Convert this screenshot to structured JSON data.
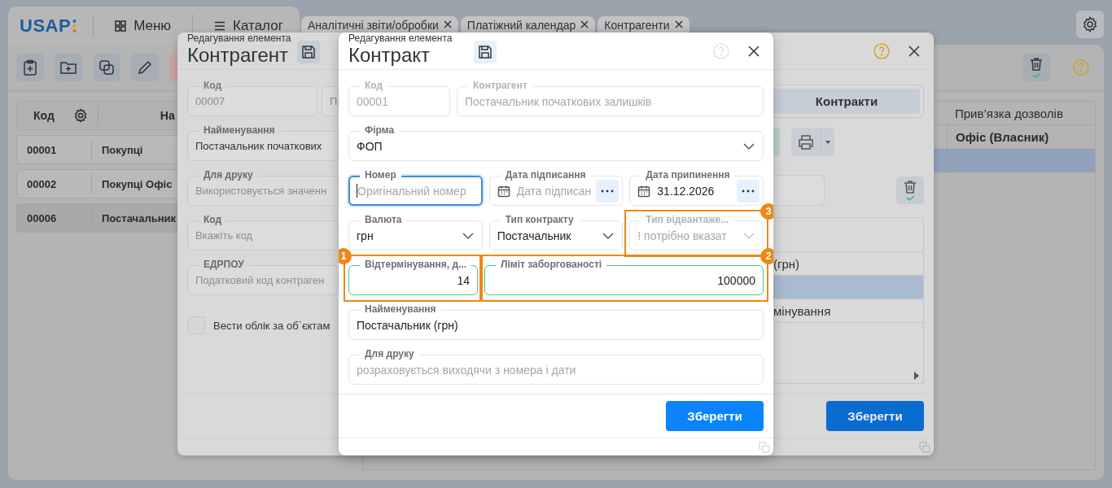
{
  "app_bar": {
    "logo": "USAP",
    "menu_button": "Меню",
    "catalog_button": "Каталог"
  },
  "tabs": [
    {
      "label": "Аналітичні звіти/обробки",
      "selected": false
    },
    {
      "label": "Платіжний календар",
      "selected": false
    },
    {
      "label": "Контрагенти",
      "selected": false
    }
  ],
  "catalog_table": {
    "columns": [
      "Код",
      "На"
    ],
    "rows": [
      {
        "code": "00001",
        "name": "Покупці",
        "selected": false
      },
      {
        "code": "00002",
        "name": "Покупці Офіс",
        "selected": false
      },
      {
        "code": "00006",
        "name": "Постачальник",
        "selected": true
      }
    ]
  },
  "permissions_table": {
    "column": "Прив’язка дозволів",
    "rows": [
      {
        "text": "Офіс (Власник)",
        "selected": false
      },
      {
        "selected": true
      }
    ]
  },
  "contractor_dialog": {
    "subtitle": "Редагування елемента",
    "title": "Контрагент",
    "rows": [
      [
        {
          "kind": "text",
          "label": "Код",
          "value": "00007",
          "disabled": true
        },
        {
          "kind": "text",
          "value": "П",
          "disabled": true
        }
      ],
      [
        {
          "kind": "text",
          "label": "Найменування",
          "value": "Постачальник початкових",
          "disabled": false
        }
      ],
      [
        {
          "kind": "text",
          "label": "Для друку",
          "placeholder": "Використовується значенн",
          "disabled": false
        }
      ],
      [
        {
          "kind": "text",
          "label": "Код",
          "placeholder": "Вкажіть код",
          "disabled": false
        }
      ],
      [
        {
          "kind": "text",
          "label": "ЕДРПОУ",
          "placeholder": "Податковий код контраген",
          "disabled": false
        }
      ]
    ],
    "checkbox": {
      "label": "Вести облік за об`єктам",
      "checked": false
    },
    "tabs": [
      {
        "label": "Контракти",
        "selected": true
      }
    ],
    "table_rows": [
      {
        "text": "(грн)",
        "selected": false
      },
      {
        "selected": true
      },
      {
        "text": "мінування",
        "selected": false
      }
    ],
    "save_button": "Зберегти"
  },
  "contract_dialog": {
    "subtitle": "Редагування елемента",
    "title": "Контракт",
    "rows": [
      [
        {
          "kind": "text",
          "label": "Код",
          "value": "00001",
          "disabled": true
        },
        {
          "kind": "text",
          "label": "Контрагент",
          "value": "Постачальник початкових залишків",
          "disabled": true
        }
      ],
      [
        {
          "kind": "select",
          "label": "Фірма",
          "value": "ФОП",
          "disabled": false
        }
      ],
      [
        {
          "kind": "text",
          "label": "Номер",
          "placeholder": "Оригінальний номер",
          "disabled": false,
          "focused": true
        },
        {
          "kind": "date",
          "label": "Дата підписання",
          "placeholder": "Дата підписан",
          "disabled": false
        },
        {
          "kind": "date",
          "label": "Дата припинення",
          "value": "31.12.2026",
          "disabled": false
        }
      ],
      [
        {
          "kind": "select",
          "label": "Валюта",
          "value": "грн",
          "disabled": false
        },
        {
          "kind": "select",
          "label": "Тип контракту",
          "value": "Постачальник",
          "disabled": false
        },
        {
          "kind": "select",
          "label": "Тип відвантаже...",
          "placeholder": "! потрібно вказат",
          "disabled": true,
          "annotation": "3"
        }
      ],
      [
        {
          "kind": "number",
          "label": "Відтермінування, д...",
          "value": "14",
          "disabled": false,
          "valid": true,
          "annotation": "1"
        },
        {
          "kind": "number",
          "label": "Ліміт заборгованості",
          "value": "100000",
          "disabled": false,
          "valid": true,
          "annotation": "2"
        }
      ],
      [
        {
          "kind": "text",
          "label": "Найменування",
          "value": "Постачальник (грн)",
          "disabled": false
        }
      ],
      [
        {
          "kind": "text",
          "label": "Для друку",
          "placeholder": "розраховується виходячи з номера і дати",
          "disabled": false
        }
      ]
    ],
    "save_button": "Зберегти"
  }
}
